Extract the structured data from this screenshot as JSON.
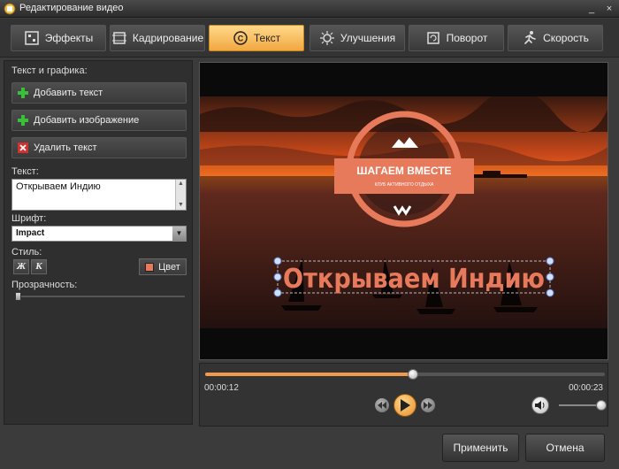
{
  "window": {
    "title": "Редактирование видео",
    "icon": "film-icon",
    "controls": {
      "minimize": "_",
      "close": "×"
    }
  },
  "tabs": [
    {
      "label": "Эффекты",
      "icon": "effects-icon",
      "active": false
    },
    {
      "label": "Кадрирование",
      "icon": "crop-icon",
      "active": false
    },
    {
      "label": "Текст",
      "icon": "text-icon",
      "active": true
    },
    {
      "label": "Улучшения",
      "icon": "sun-icon",
      "active": false
    },
    {
      "label": "Поворот",
      "icon": "rotate-icon",
      "active": false
    },
    {
      "label": "Скорость",
      "icon": "runner-icon",
      "active": false
    }
  ],
  "panel": {
    "section_title": "Текст и графика:",
    "actions": [
      {
        "label": "Добавить текст",
        "icon": "plus-icon"
      },
      {
        "label": "Добавить изображение",
        "icon": "plus-icon"
      },
      {
        "label": "Удалить текст",
        "icon": "delete-icon"
      }
    ],
    "text_label": "Текст:",
    "text_value": "Открываем Индию",
    "font_label": "Шрифт:",
    "font_value": "Impact",
    "style_label": "Стиль:",
    "bold_label": "Ж",
    "italic_label": "К",
    "color_label": "Цвет",
    "color_value": "#e87a5c",
    "opacity_label": "Прозрачность:",
    "opacity_value": 0
  },
  "video": {
    "overlay_text": "Открываем Индию",
    "badge_title": "ШАГАЕМ ВМЕСТЕ",
    "badge_subtitle": "КЛУБ АКТИВНОГО ОТДЫХА",
    "badge_color": "#e87a5c"
  },
  "player": {
    "current_time": "00:00:12",
    "total_time": "00:00:23",
    "progress": 0.52,
    "volume": 0.85
  },
  "footer": {
    "apply_label": "Применить",
    "cancel_label": "Отмена"
  }
}
